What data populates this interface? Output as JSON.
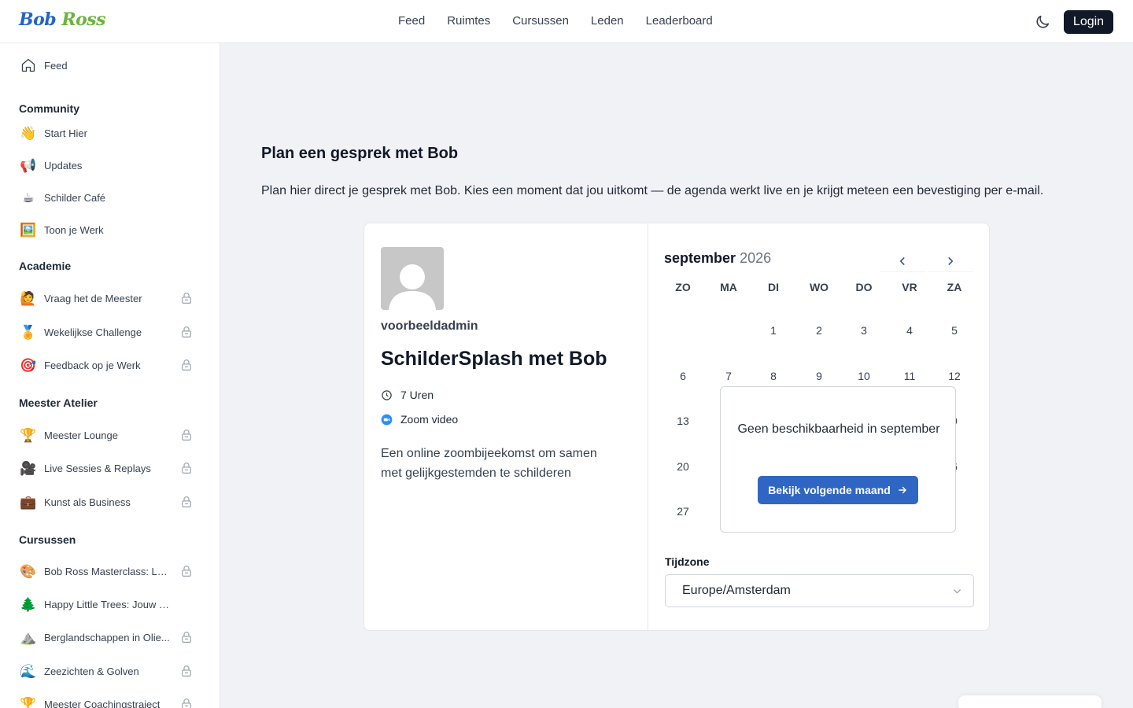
{
  "brand": {
    "name_part1": "Bob",
    "name_part2": "Ross"
  },
  "topnav": {
    "items": [
      "Feed",
      "Ruimtes",
      "Cursussen",
      "Leden",
      "Leaderboard"
    ],
    "login_label": "Login"
  },
  "sidebar": {
    "feed": {
      "label": "Feed",
      "icon": "home-icon"
    },
    "sections": [
      {
        "title": "Community",
        "items": [
          {
            "label": "Start Hier",
            "icon": "👋",
            "locked": false
          },
          {
            "label": "Updates",
            "icon": "📢",
            "locked": false
          },
          {
            "label": "Schilder Café",
            "icon": "☕",
            "locked": false
          },
          {
            "label": "Toon je Werk",
            "icon": "🖼️",
            "locked": false
          }
        ]
      },
      {
        "title": "Academie",
        "items": [
          {
            "label": "Vraag het de Meester",
            "icon": "🙋",
            "locked": true
          },
          {
            "label": "Wekelijkse Challenge",
            "icon": "🏅",
            "locked": true
          },
          {
            "label": "Feedback op je Werk",
            "icon": "🎯",
            "locked": true
          }
        ]
      },
      {
        "title": "Meester Atelier",
        "items": [
          {
            "label": "Meester Lounge",
            "icon": "🏆",
            "locked": true
          },
          {
            "label": "Live Sessies & Replays",
            "icon": "🎥",
            "locked": true
          },
          {
            "label": "Kunst als Business",
            "icon": "💼",
            "locked": true
          }
        ]
      },
      {
        "title": "Cursussen",
        "items": [
          {
            "label": "Bob Ross Masterclass: Lan...",
            "icon": "🎨",
            "locked": true
          },
          {
            "label": "Happy Little Trees: Jouw Eerste ...",
            "icon": "🌲",
            "locked": false
          },
          {
            "label": "Berglandschappen in Olie...",
            "icon": "⛰️",
            "locked": true
          },
          {
            "label": "Zeezichten & Golven",
            "icon": "🌊",
            "locked": true
          },
          {
            "label": "Meester Coachingstraject",
            "icon": "🏆",
            "locked": true
          }
        ]
      }
    ]
  },
  "main": {
    "title": "Plan een gesprek met Bob",
    "description": "Plan hier direct je gesprek met Bob. Kies een moment dat jou uitkomt — de agenda werkt live en je krijgt meteen een bevestiging per e-mail."
  },
  "event": {
    "host": "voorbeeldadmin",
    "title": "SchilderSplash met Bob",
    "duration": "7 Uren",
    "location": "Zoom video",
    "description": "Een online zoombijeekomst om samen met gelijkgestemden te schilderen"
  },
  "calendar": {
    "month": "september",
    "year": "2026",
    "weekdays": [
      "ZO",
      "MA",
      "DI",
      "WO",
      "DO",
      "VR",
      "ZA"
    ],
    "weeks": [
      [
        "",
        "",
        "1",
        "2",
        "3",
        "4",
        "5"
      ],
      [
        "6",
        "7",
        "8",
        "9",
        "10",
        "11",
        "12"
      ],
      [
        "13",
        "",
        "",
        "",
        "",
        "",
        "9"
      ],
      [
        "20",
        "",
        "",
        "",
        "",
        "",
        "6"
      ],
      [
        "27",
        "",
        "",
        "",
        "",
        "",
        ""
      ]
    ],
    "no_availability": "Geen beschikbaarheid in september",
    "next_month_label": "Bekijk volgende maand",
    "timezone_label": "Tijdzone",
    "timezone_value": "Europe/Amsterdam"
  },
  "colors": {
    "accent": "#2f66c4",
    "brand_blue": "#2563c9",
    "brand_green": "#6cb33f",
    "login_bg": "#111827"
  }
}
